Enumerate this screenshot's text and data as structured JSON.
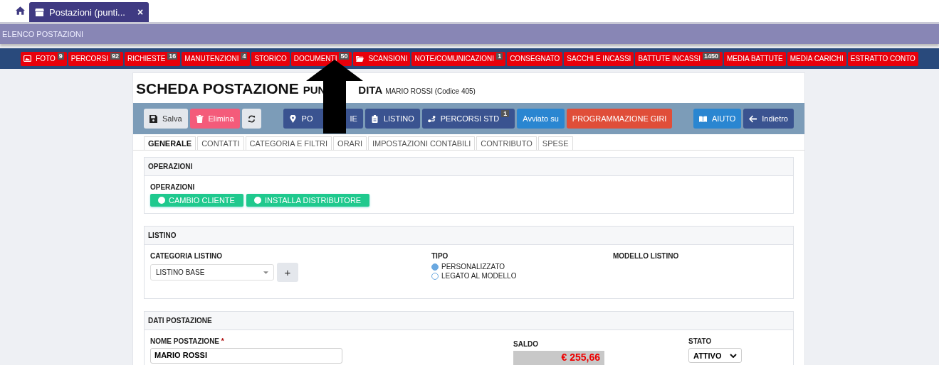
{
  "top_tabs": {
    "tabs": [
      {
        "label": "Postazioni (punti...",
        "close": "×",
        "selected": true
      }
    ]
  },
  "breadcrumb": "ELENCO POSTAZIONI",
  "nav": [
    {
      "label": "FOTO",
      "badge": "9",
      "kind": "photo"
    },
    {
      "label": "PERCORSI",
      "badge": "92",
      "kind": "plain"
    },
    {
      "label": "RICHIESTE",
      "badge": "16",
      "kind": "plain"
    },
    {
      "label": "MANUTENZIONI",
      "badge": "4",
      "kind": "plain"
    },
    {
      "label": "STORICO",
      "kind": "plain"
    },
    {
      "label": "DOCUMENTI",
      "badge": "50",
      "kind": "plain"
    },
    {
      "label": "SCANSIONI",
      "kind": "folder"
    },
    {
      "label": "NOTE/COMUNICAZIONI",
      "badge": "1",
      "kind": "plain"
    },
    {
      "label": "CONSEGNATO",
      "kind": "plain"
    },
    {
      "label": "SACCHI E INCASSI",
      "kind": "plain"
    },
    {
      "label": "BATTUTE INCASSI",
      "badge": "1450",
      "kind": "plain"
    },
    {
      "label": "MEDIA BATTUTE",
      "kind": "plain"
    },
    {
      "label": "MEDIA CARICHI",
      "kind": "plain"
    },
    {
      "label": "ESTRATTO CONTO",
      "kind": "plain"
    }
  ],
  "title": "SCHEDA POSTAZIONE",
  "subtitle_parts": [
    "PUN",
    "DITA"
  ],
  "owner": "MARIO ROSSI (Codice 405)",
  "toolbar": [
    {
      "label": "Salva",
      "kind": "light"
    },
    {
      "label": "Elimina",
      "kind": "danger"
    },
    {
      "kind": "light"
    },
    {
      "label_parts": [
        "PO",
        "IE"
      ],
      "kind": "primary"
    },
    {
      "label": "LISTINO",
      "kind": "primary"
    },
    {
      "label": "PERCORSI STD",
      "badge": "1",
      "kind": "primary"
    },
    {
      "label": "Avviato su",
      "kind": "info"
    },
    {
      "label": "PROGRAMMAZIONE GIRI",
      "kind": "warning"
    },
    {
      "label": "AIUTO",
      "kind": "info"
    },
    {
      "label": "Indietro",
      "kind": "primary"
    }
  ],
  "tabs": [
    {
      "label": "GENERALE",
      "selected": true
    },
    {
      "label": "CONTATTI",
      "selected": false
    },
    {
      "label": "CATEGORIA E FILTRI",
      "selected": false
    },
    {
      "label": "ORARI",
      "selected": false
    },
    {
      "label": "IMPOSTAZIONI CONTABILI",
      "selected": false
    },
    {
      "label": "CONTRIBUTO",
      "selected": false
    },
    {
      "label": "SPESE",
      "selected": false
    }
  ],
  "operazioni": {
    "header": "OPERAZIONI",
    "label": "OPERAZIONI",
    "toggles": [
      {
        "label": "CAMBIO CLIENTE",
        "checked": false
      },
      {
        "label": "INSTALLA DISTRIBUTORE",
        "checked": false
      }
    ]
  },
  "listino": {
    "header": "LISTINO",
    "categoria_label": "CATEGORIA LISTINO",
    "categoria_value": "LISTINO BASE",
    "add": "+",
    "tipo_label": "TIPO",
    "tipo_options": [
      {
        "label": "PERSONALIZZATO",
        "selected": true
      },
      {
        "label": "LEGATO AL MODELLO",
        "selected": false
      }
    ],
    "modello_label": "MODELLO LISTINO"
  },
  "dati": {
    "header": "DATI POSTAZIONE",
    "nome_label": "NOME POSTAZIONE",
    "required": "*",
    "nome_value": "MARIO ROSSI",
    "saldo_label": "SALDO",
    "saldo_value": "€ 255,66",
    "stato_label": "STATO",
    "stato_value": "ATTIVO"
  },
  "annotation": {
    "kind": "arrow"
  }
}
